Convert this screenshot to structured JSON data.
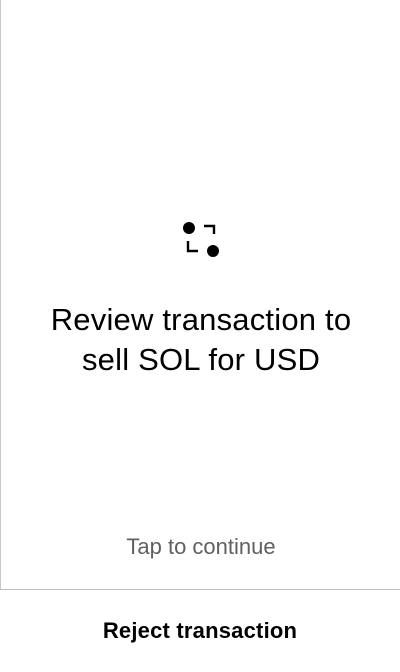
{
  "screen": {
    "icon": "swap-icon",
    "title_line1": "Review transaction to",
    "title_line2": "sell SOL for USD",
    "tap_hint": "Tap to continue"
  },
  "footer": {
    "reject_label": "Reject transaction"
  },
  "colors": {
    "background": "#ffffff",
    "text": "#000000",
    "hint": "#606060",
    "divider": "#bdbdbd"
  }
}
